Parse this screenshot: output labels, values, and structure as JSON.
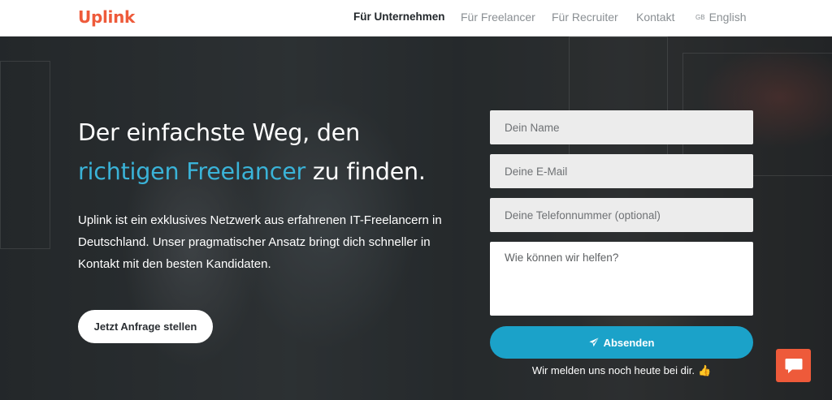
{
  "brand": {
    "logo_text": "Uplink",
    "accent_color": "#ee5a3a"
  },
  "nav": {
    "items": [
      {
        "label": "Für Unternehmen",
        "active": true
      },
      {
        "label": "Für Freelancer",
        "active": false
      },
      {
        "label": "Für Recruiter",
        "active": false
      },
      {
        "label": "Kontakt",
        "active": false
      }
    ],
    "language": {
      "flag": "GB",
      "label": "English"
    }
  },
  "hero": {
    "headline_part1": "Der einfachste Weg, den",
    "headline_highlight": "richtigen Freelancer",
    "headline_part2": "zu finden.",
    "highlight_color": "#3ab3d8",
    "lead": "Uplink ist ein exklusives Netzwerk aus erfahrenen IT-Freelancern in Deutschland. Unser pragmatischer Ansatz bringt dich schneller in Kontakt mit den besten Kandidaten.",
    "cta_label": "Jetzt Anfrage stellen"
  },
  "form": {
    "name_placeholder": "Dein Name",
    "email_placeholder": "Deine E-Mail",
    "phone_placeholder": "Deine Telefonnummer (optional)",
    "message_placeholder": "Wie können wir helfen?",
    "submit_label": "Absenden",
    "submit_icon": "paper-plane-icon",
    "submit_color": "#1ba2c9",
    "note": "Wir melden uns noch heute bei dir.",
    "note_emoji": "👍"
  },
  "chat_widget": {
    "icon": "chat-bubble-icon",
    "color": "#ee5a3a"
  }
}
